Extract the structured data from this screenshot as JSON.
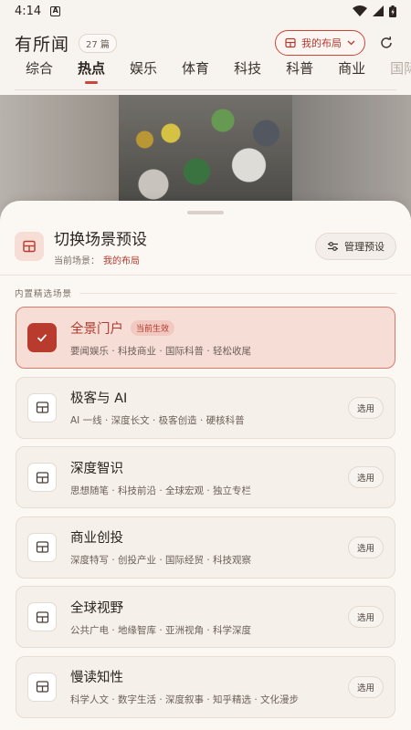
{
  "status_bar": {
    "time": "4:14",
    "notification_letter": "A"
  },
  "header": {
    "app_title": "有所闻",
    "count_badge": "27 篇",
    "layout_button": "我的布局"
  },
  "tabs": [
    {
      "label": "综合",
      "active": false
    },
    {
      "label": "热点",
      "active": true
    },
    {
      "label": "娱乐",
      "active": false
    },
    {
      "label": "体育",
      "active": false
    },
    {
      "label": "科技",
      "active": false
    },
    {
      "label": "科普",
      "active": false
    },
    {
      "label": "商业",
      "active": false
    },
    {
      "label": "国际",
      "active": false
    }
  ],
  "sheet": {
    "title": "切换场景预设",
    "current_label": "当前场景：",
    "current_value": "我的布局",
    "manage_button": "管理预设",
    "section_label": "内置精选场景",
    "cards": [
      {
        "title": "全景门户",
        "badge": "当前生效",
        "desc": "要闻娱乐 · 科技商业 · 国际科普 · 轻松收尾",
        "active": true
      },
      {
        "title": "极客与 AI",
        "desc": "AI 一线 · 深度长文 · 极客创造 · 硬核科普",
        "button": "选用"
      },
      {
        "title": "深度智识",
        "desc": "思想随笔 · 科技前沿 · 全球宏观 · 独立专栏",
        "button": "选用"
      },
      {
        "title": "商业创投",
        "desc": "深度特写 · 创投产业 · 国际经贸 · 科技观察",
        "button": "选用"
      },
      {
        "title": "全球视野",
        "desc": "公共广电 · 地缘智库 · 亚洲视角 · 科学深度",
        "button": "选用"
      },
      {
        "title": "慢读知性",
        "desc": "科学人文 · 数字生活 · 深度叙事 · 知乎精选 · 文化漫步",
        "button": "选用"
      }
    ]
  },
  "colors": {
    "accent": "#b83b2d",
    "accent_light": "#f6ddd6",
    "sheet_bg": "#fbf8f4"
  }
}
